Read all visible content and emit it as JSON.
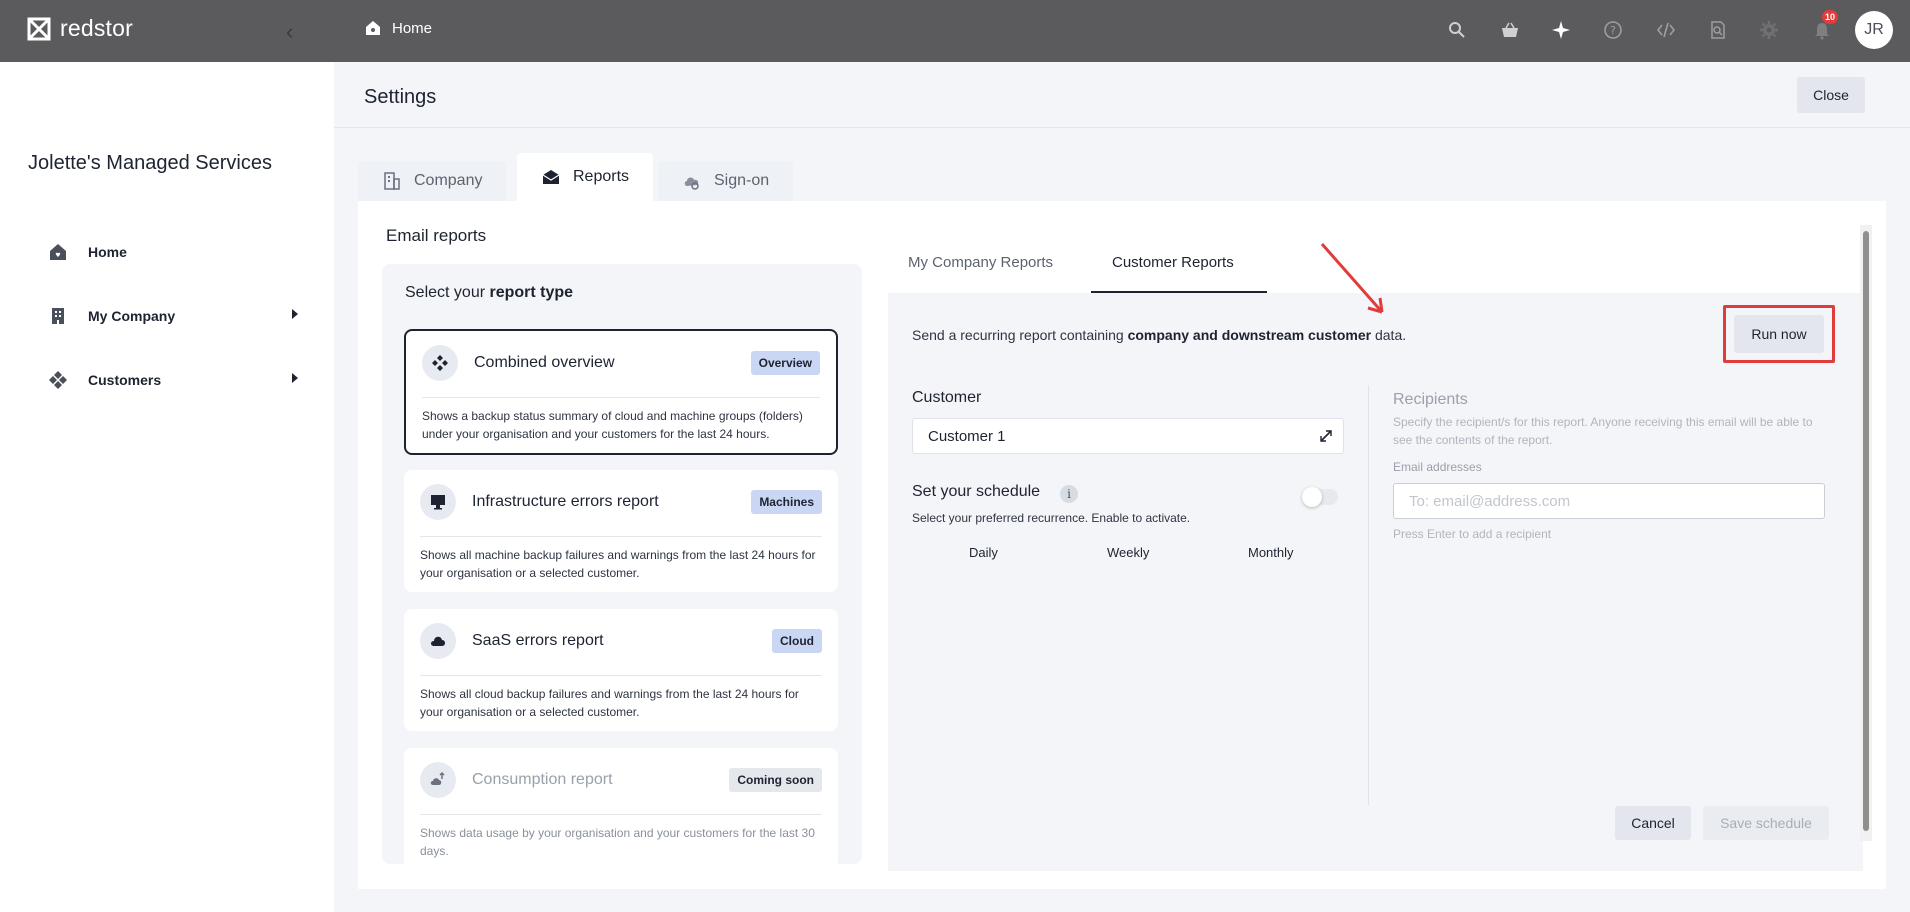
{
  "topbar": {
    "brand": "redstor",
    "breadcrumb": "Home",
    "notification_count": "10",
    "avatar_initials": "JR",
    "icons": [
      "search-icon",
      "basket-icon",
      "sparkle-icon",
      "help-icon",
      "code-icon",
      "document-search-icon",
      "gear-icon",
      "bell-icon"
    ]
  },
  "sidebar": {
    "org_name": "Jolette's Managed Services",
    "items": [
      {
        "label": "Home",
        "icon": "home-icon"
      },
      {
        "label": "My Company",
        "icon": "building-icon"
      },
      {
        "label": "Customers",
        "icon": "customers-icon"
      }
    ]
  },
  "settings": {
    "title": "Settings",
    "close_label": "Close",
    "tabs": [
      {
        "label": "Company",
        "icon": "company-icon"
      },
      {
        "label": "Reports",
        "icon": "envelope-icon"
      },
      {
        "label": "Sign-on",
        "icon": "cloud-key-icon"
      }
    ]
  },
  "email_reports": {
    "title": "Email reports",
    "select_prefix": "Select your ",
    "select_bold": "report type",
    "cards": [
      {
        "title": "Combined overview",
        "tag": "Overview",
        "desc": "Shows a backup status summary of cloud and machine groups (folders) under your organisation and your customers for the last 24 hours."
      },
      {
        "title": "Infrastructure errors report",
        "tag": "Machines",
        "desc": "Shows all machine backup failures and warnings from the last 24 hours for your organisation or a selected customer."
      },
      {
        "title": "SaaS errors report",
        "tag": "Cloud",
        "desc": "Shows all cloud backup failures and warnings from the last 24 hours for your organisation or a selected customer."
      },
      {
        "title": "Consumption report",
        "tag": "Coming soon",
        "desc": "Shows data usage by your organisation and your customers for the last 30 days."
      }
    ]
  },
  "customer_reports": {
    "subtabs": [
      "My Company Reports",
      "Customer Reports"
    ],
    "send_prefix": "Send a recurring report containing ",
    "send_bold": "company and downstream customer",
    "send_suffix": " data.",
    "run_now_label": "Run now",
    "customer_label": "Customer",
    "customer_value": "Customer 1",
    "schedule_label": "Set your schedule",
    "info_glyph": "i",
    "schedule_hint": "Select your preferred recurrence. Enable to activate.",
    "frequencies": [
      "Daily",
      "Weekly",
      "Monthly"
    ],
    "recipients_title": "Recipients",
    "recipients_desc": "Specify the recipient/s for this report. Anyone receiving this email will be able to see the contents of the report.",
    "email_label": "Email addresses",
    "email_placeholder": "To: email@address.com",
    "email_hint": "Press Enter to add a recipient",
    "cancel_label": "Cancel",
    "save_label": "Save schedule"
  },
  "colors": {
    "topbar": "#5b5b5d",
    "highlight": "#e23b3b",
    "tag": "#c9d6f4"
  }
}
